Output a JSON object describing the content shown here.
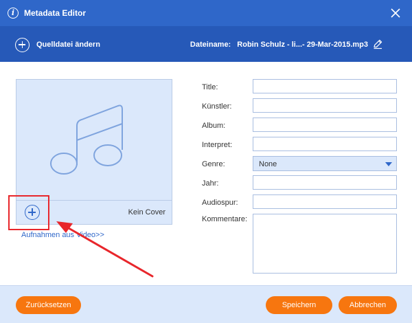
{
  "window": {
    "title": "Metadata Editor",
    "info_icon": "i"
  },
  "subbar": {
    "add_source_label": "Quelldatei ändern",
    "filename_label": "Dateiname:",
    "filename_value": "Robin Schulz - li...- 29-Mar-2015.mp3"
  },
  "cover": {
    "no_cover_label": "Kein Cover",
    "record_link": "Aufnahmen aus Video>>"
  },
  "fields": {
    "title": {
      "label": "Title:",
      "value": ""
    },
    "artist": {
      "label": "Künstler:",
      "value": ""
    },
    "album": {
      "label": "Album:",
      "value": ""
    },
    "performer": {
      "label": "Interpret:",
      "value": ""
    },
    "genre": {
      "label": "Genre:",
      "value": "None"
    },
    "year": {
      "label": "Jahr:",
      "value": ""
    },
    "track": {
      "label": "Audiospur:",
      "value": ""
    },
    "comments": {
      "label": "Kommentare:",
      "value": ""
    }
  },
  "footer": {
    "reset_label": "Zurücksetzen",
    "save_label": "Speichern",
    "cancel_label": "Abbrechen"
  },
  "colors": {
    "titlebar": "#2f67c9",
    "subbar": "#2659b8",
    "button": "#f7760f",
    "highlight": "#e8262b",
    "panel": "#dbe8fb"
  },
  "icons": [
    "info-icon",
    "close-icon",
    "add-circle-icon",
    "edit-pencil-icon",
    "music-note-icon",
    "dropdown-caret-icon"
  ]
}
